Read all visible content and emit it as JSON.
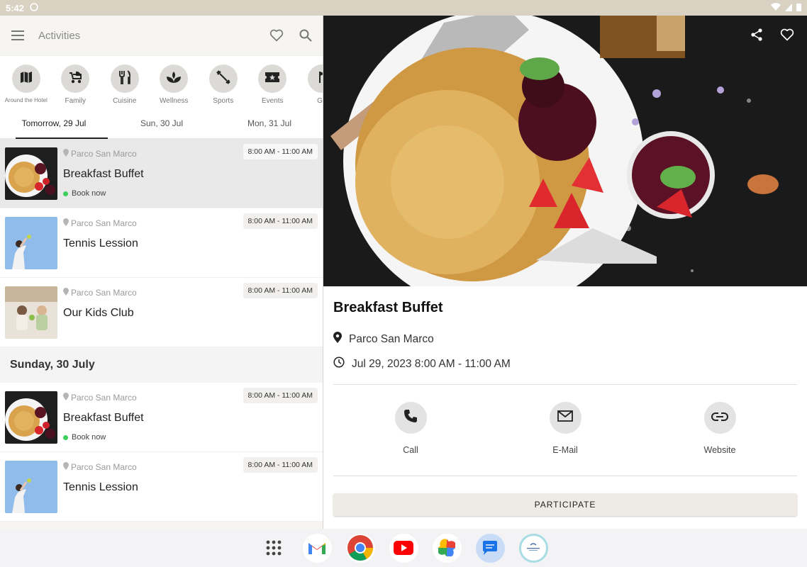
{
  "status": {
    "time": "5:42"
  },
  "topbar": {
    "title": "Activities"
  },
  "categories": [
    {
      "label": "Around the Hotel",
      "icon": "map-icon"
    },
    {
      "label": "Family",
      "icon": "stroller-icon"
    },
    {
      "label": "Cuisine",
      "icon": "cutlery-icon"
    },
    {
      "label": "Wellness",
      "icon": "spa-icon"
    },
    {
      "label": "Sports",
      "icon": "dumbbell-icon"
    },
    {
      "label": "Events",
      "icon": "ticket-icon"
    },
    {
      "label": "Go",
      "icon": "golf-icon"
    }
  ],
  "tabs": [
    {
      "label": "Tomorrow, 29 Jul",
      "active": true
    },
    {
      "label": "Sun, 30 Jul",
      "active": false
    },
    {
      "label": "Mon, 31 Jul",
      "active": false
    }
  ],
  "list_today": [
    {
      "location": "Parco San Marco",
      "name": "Breakfast Buffet",
      "time": "8:00 AM - 11:00 AM",
      "book": "Book now"
    },
    {
      "location": "Parco San Marco",
      "name": "Tennis Lession",
      "time": "8:00 AM - 11:00 AM"
    },
    {
      "location": "Parco San Marco",
      "name": "Our Kids Club",
      "time": "8:00 AM - 11:00 AM"
    }
  ],
  "section_sunday": "Sunday, 30 July",
  "list_sunday": [
    {
      "location": "Parco San Marco",
      "name": "Breakfast Buffet",
      "time": "8:00 AM - 11:00 AM",
      "book": "Book now"
    },
    {
      "location": "Parco San Marco",
      "name": "Tennis Lession",
      "time": "8:00 AM - 11:00 AM"
    }
  ],
  "detail": {
    "title": "Breakfast Buffet",
    "location": "Parco San Marco",
    "datetime": "Jul 29, 2023 8:00 AM - 11:00 AM",
    "contacts": [
      {
        "label": "Call",
        "icon": "phone-icon"
      },
      {
        "label": "E-Mail",
        "icon": "mail-icon"
      },
      {
        "label": "Website",
        "icon": "link-icon"
      }
    ],
    "participate": "PARTICIPATE"
  },
  "dock_apps": [
    "apps-grid-icon",
    "gmail-icon",
    "chrome-icon",
    "youtube-icon",
    "photos-icon",
    "messages-icon",
    "hotel-app-icon"
  ],
  "colors": {
    "accent_green": "#3ccf5b",
    "status_bar": "#d9d2c3",
    "button_bg": "#eeebe5"
  }
}
